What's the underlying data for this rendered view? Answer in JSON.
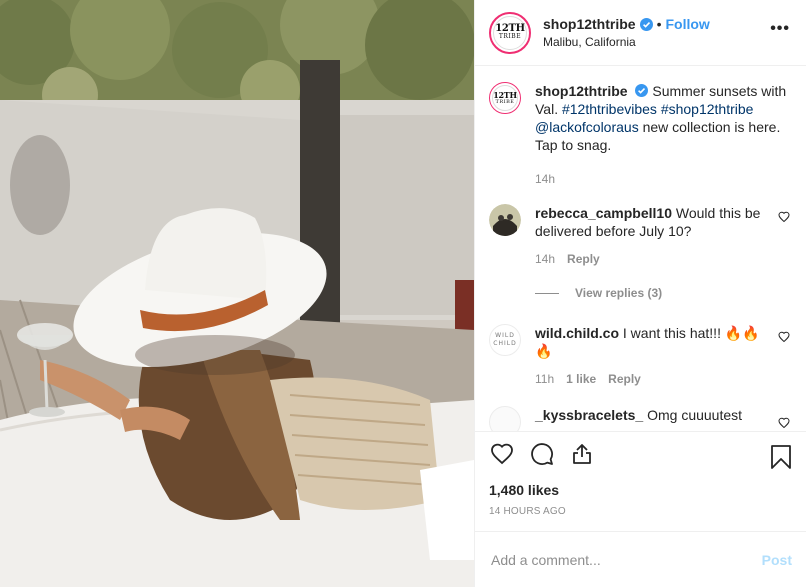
{
  "header": {
    "username": "shop12thtribe",
    "follow_label": "Follow",
    "separator": "•",
    "location": "Malibu, California",
    "more_label": "•••",
    "avatar_line1": "12TH",
    "avatar_line2": "TRIBE"
  },
  "caption": {
    "username": "shop12thtribe",
    "text_before": "Summer sunsets with Val.",
    "hashtag1": "#12thtribevibes",
    "hashtag2": "#shop12thtribe",
    "mention": "@lackofcoloraus",
    "text_after": "new collection is here. Tap to snag.",
    "time": "14h"
  },
  "comments": [
    {
      "username": "rebecca_campbell10",
      "text": "Would this be delivered before July 10?",
      "time": "14h",
      "reply": "Reply"
    },
    {
      "username": "wild.child.co",
      "text": "I want this hat!!! 🔥🔥🔥",
      "time": "11h",
      "likes": "1 like",
      "reply": "Reply",
      "avatar_text1": "WILD",
      "avatar_text2": "CHILD"
    },
    {
      "username": "_kyssbracelets_",
      "text": "Omg cuuuutest"
    }
  ],
  "view_replies": "View replies (3)",
  "actions": {
    "likes": "1,480 likes",
    "ago": "14 HOURS AGO"
  },
  "add_comment": {
    "placeholder": "Add a comment...",
    "post_label": "Post"
  },
  "icons": [
    "heart-icon",
    "comment-icon",
    "share-icon",
    "bookmark-icon",
    "verified-icon",
    "more-icon"
  ],
  "colors": {
    "follow": "#3897f0",
    "link": "#003569",
    "muted": "#8e8e8e",
    "post_disabled": "#b2dffc",
    "story_ring": "#ef2e72"
  }
}
